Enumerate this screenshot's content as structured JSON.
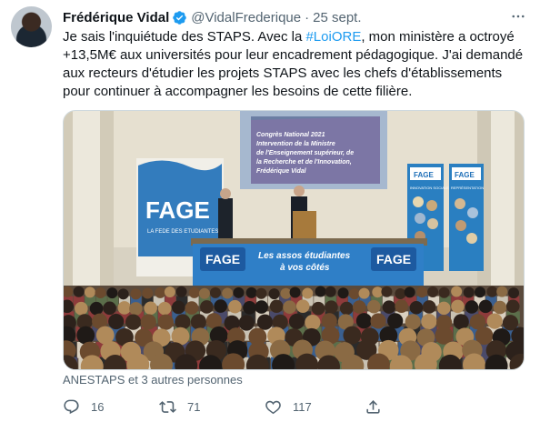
{
  "tweet": {
    "author_name": "Frédérique Vidal",
    "author_handle": "@VidalFrederique",
    "separator": "·",
    "date": "25 sept.",
    "text_lines": [
      [
        "Je sais l'inquiétude des STAPS. Avec la ",
        "#LoiORE",
        ", mon ministère a octroyé"
      ],
      [
        "+13,5M€ aux universités pour leur encadrement pédagogique. J'ai demandé"
      ],
      [
        "aux recteurs d'étudier les projets STAPS avec les chefs d'établissements"
      ],
      [
        "pour continuer à accompagner les besoins de cette filière."
      ]
    ],
    "liked_by": "ANESTAPS et 3 autres personnes",
    "reply_count": "16",
    "retweet_count": "71",
    "like_count": "117"
  },
  "media": {
    "screen_lines": [
      "Congrès National 2021",
      "Intervention de la Ministre",
      "de l'Enseignement supérieur, de",
      "la Recherche et de l'Innovation,",
      "Frédérique Vidal"
    ],
    "fage_logo": "FAGE",
    "fage_sub": "LA FEDE DES ETUDIANTES",
    "banner_line1": "Les assos étudiantes",
    "banner_line2": "à vos côtés",
    "rollup1_logo": "FAGE",
    "rollup1_label": "INNOVATION SOCIALE",
    "rollup2_logo": "FAGE",
    "rollup2_label": "REPRÉSENTATION"
  },
  "colors": {
    "text": "#0f1419",
    "secondary": "#536471",
    "link": "#1d9bf0",
    "verified": "#1d9bf0",
    "fage_blue": "#1e6fb8"
  },
  "icons": {
    "verified": "verified-badge-icon",
    "more": "more-dots-icon",
    "reply": "reply-icon",
    "retweet": "retweet-icon",
    "like": "heart-icon",
    "share": "share-icon"
  }
}
